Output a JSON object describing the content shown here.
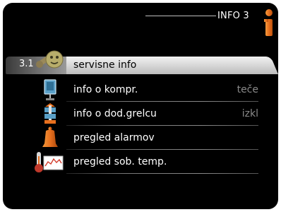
{
  "header": {
    "title": "INFO 3",
    "icon": "info-icon"
  },
  "menu": {
    "selected_number": "3.1",
    "items": [
      {
        "label": "servisne info",
        "value": "",
        "icon": "service-icon"
      },
      {
        "label": "info o kompr.",
        "value": "teče",
        "icon": "compressor-icon"
      },
      {
        "label": "info o dod.grelcu",
        "value": "izkl",
        "icon": "heater-icon"
      },
      {
        "label": "pregled alarmov",
        "value": "",
        "icon": "alarm-bell-icon"
      },
      {
        "label": "pregled sob. temp.",
        "value": "",
        "icon": "room-temperature-icon"
      }
    ]
  },
  "colors": {
    "accent": "#e8701e",
    "highlight": "#d9d9d9",
    "background": "#000000"
  }
}
